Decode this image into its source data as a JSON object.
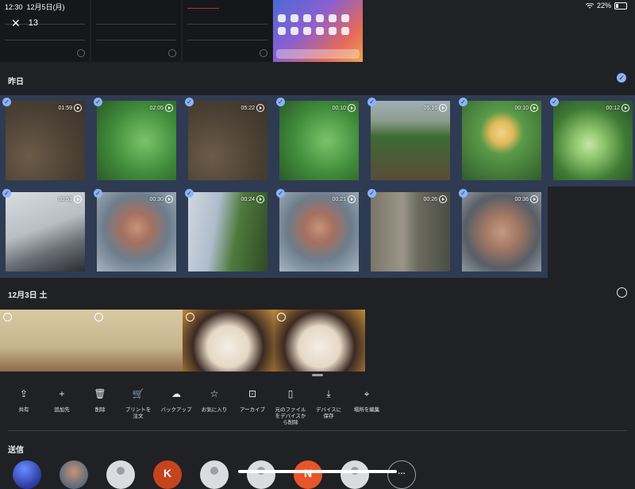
{
  "status": {
    "time": "12:30",
    "date": "12月5日(月)",
    "battery": "22%"
  },
  "selection": {
    "count": "13"
  },
  "sections": [
    {
      "title": "昨日",
      "all_selected": true
    },
    {
      "title": "12月3日 土",
      "all_selected": false
    }
  ],
  "yesterday_tiles": [
    {
      "duration": "01:59",
      "kind": "soil"
    },
    {
      "duration": "02:05",
      "kind": "leaf"
    },
    {
      "duration": "05:22",
      "kind": "soil"
    },
    {
      "duration": "00:10",
      "kind": "leaf"
    },
    {
      "duration": "05:16",
      "kind": "garden"
    },
    {
      "duration": "00:10",
      "kind": "cauli"
    },
    {
      "duration": "00:12",
      "kind": "cabbage"
    },
    {
      "duration": "00:51",
      "kind": "car"
    },
    {
      "duration": "00:30",
      "kind": "face"
    },
    {
      "duration": "00:24",
      "kind": "sky"
    },
    {
      "duration": "00:21",
      "kind": "face"
    },
    {
      "duration": "00:26",
      "kind": "wall"
    },
    {
      "duration": "00:36",
      "kind": "face2"
    }
  ],
  "dec3_tiles": [
    {
      "kind": "menuimg"
    },
    {
      "kind": "menuimg"
    },
    {
      "kind": "ramen"
    },
    {
      "kind": "ramen"
    }
  ],
  "actions": [
    {
      "label": "共有",
      "icon": "share-icon",
      "glyph": "⇪"
    },
    {
      "label": "追加先",
      "icon": "plus-icon",
      "glyph": "+"
    },
    {
      "label": "削除",
      "icon": "trash-icon",
      "glyph": "🗑"
    },
    {
      "label": "プリントを\n注文",
      "icon": "cart-icon",
      "glyph": "🛒"
    },
    {
      "label": "バックアップ",
      "icon": "cloud-upload-icon",
      "glyph": "☁"
    },
    {
      "label": "お気に入り",
      "icon": "star-icon",
      "glyph": "☆"
    },
    {
      "label": "アーカイブ",
      "icon": "archive-icon",
      "glyph": "⊡"
    },
    {
      "label": "元のファイル\nをデバイスか\nら削除",
      "icon": "phone-delete-icon",
      "glyph": "▯"
    },
    {
      "label": "デバイスに\n保存",
      "icon": "download-icon",
      "glyph": "⤓"
    },
    {
      "label": "場所を編集",
      "icon": "location-edit-icon",
      "glyph": "⌖"
    }
  ],
  "send": {
    "title": "送信"
  },
  "contacts": [
    {
      "type": "planet",
      "initial": ""
    },
    {
      "type": "photo",
      "initial": ""
    },
    {
      "type": "person",
      "initial": ""
    },
    {
      "type": "k",
      "initial": "K"
    },
    {
      "type": "person",
      "initial": ""
    },
    {
      "type": "person",
      "initial": ""
    },
    {
      "type": "n",
      "initial": "N"
    },
    {
      "type": "person",
      "initial": ""
    },
    {
      "type": "more",
      "initial": "…"
    }
  ]
}
